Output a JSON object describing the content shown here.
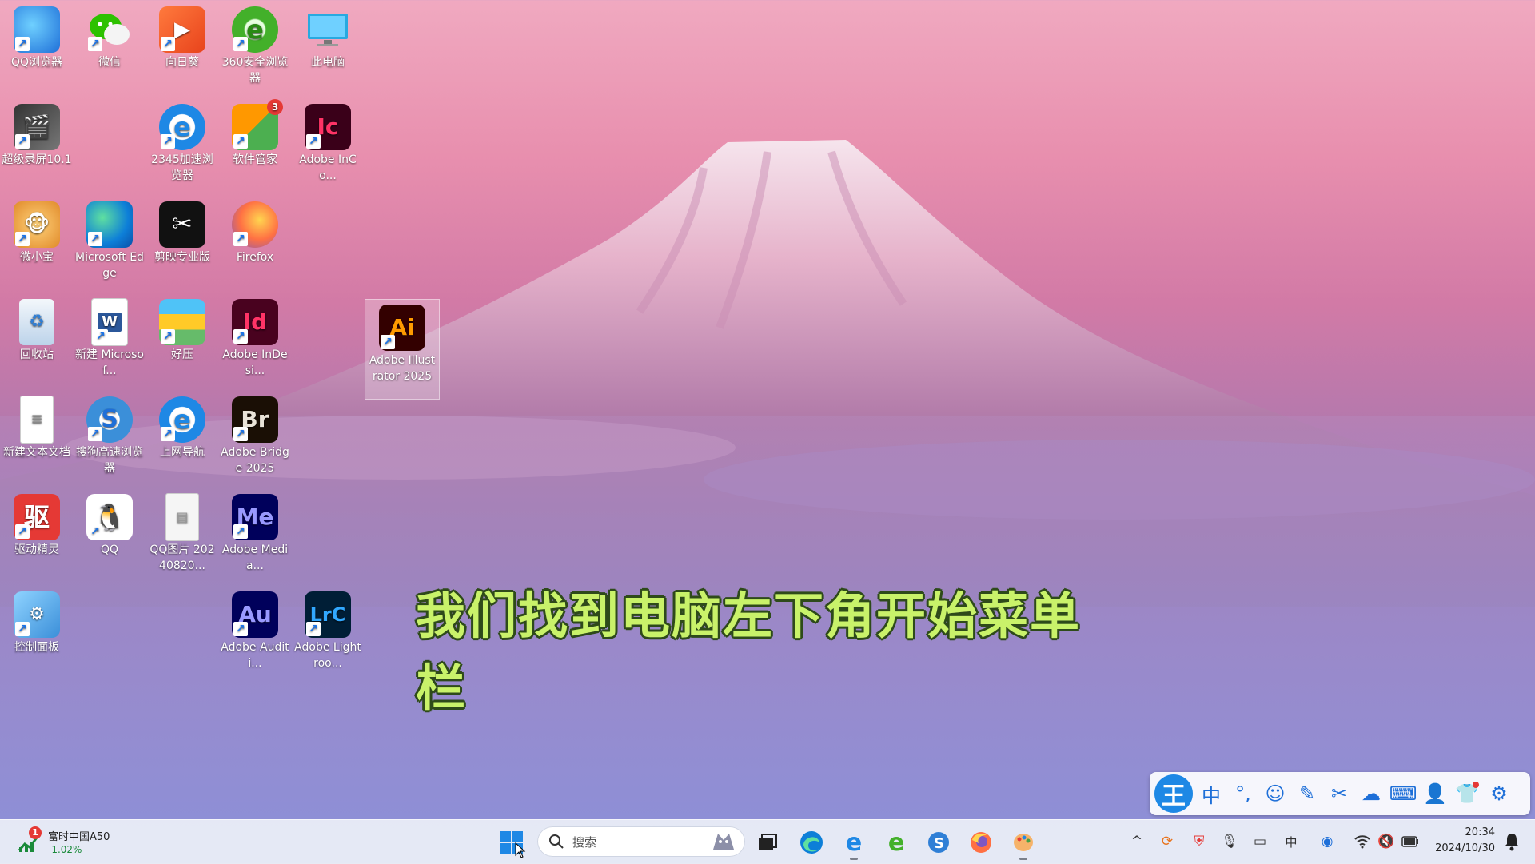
{
  "desktop": {
    "icons": [
      {
        "label": "QQ浏览器"
      },
      {
        "label": "微信"
      },
      {
        "label": "向日葵"
      },
      {
        "label": "360安全浏览器"
      },
      {
        "label": "此电脑"
      },
      {
        "label": "超级录屏10.1"
      },
      {
        "label": "2345加速浏览器"
      },
      {
        "label": "软件管家",
        "badge": "3"
      },
      {
        "label": "Adobe InCo...",
        "glyph": "Ic"
      },
      {
        "label": "微小宝"
      },
      {
        "label": "Microsoft Edge"
      },
      {
        "label": "剪映专业版"
      },
      {
        "label": "Firefox"
      },
      {
        "label": "回收站"
      },
      {
        "label": "新建 Microsof..."
      },
      {
        "label": "好压"
      },
      {
        "label": "Adobe InDesi...",
        "glyph": "Id"
      },
      {
        "label": "Adobe Illustrator 2025",
        "glyph": "Ai"
      },
      {
        "label": "新建文本文档"
      },
      {
        "label": "搜狗高速浏览器"
      },
      {
        "label": "上网导航"
      },
      {
        "label": "Adobe Bridge 2025",
        "glyph": "Br"
      },
      {
        "label": "驱动精灵"
      },
      {
        "label": "QQ"
      },
      {
        "label": "QQ图片 20240820..."
      },
      {
        "label": "Adobe Media...",
        "glyph": "Me"
      },
      {
        "label": "控制面板"
      },
      {
        "label": "Adobe Auditi...",
        "glyph": "Au"
      },
      {
        "label": "Adobe Lightroo...",
        "glyph": "LrC"
      }
    ],
    "subtitle": "我们找到电脑左下角开始菜单栏"
  },
  "ime_toolbar": {
    "logo": "王",
    "mode": "中",
    "punct": "°,"
  },
  "taskbar": {
    "stock": {
      "badge": "1",
      "name": "富时中国A50",
      "change": "-1.02%"
    },
    "search": {
      "placeholder": "搜索"
    },
    "tray": {
      "ime_indicator": "中"
    },
    "clock": {
      "time": "20:34",
      "date": "2024/10/30"
    }
  },
  "colors": {
    "subtitle": "#c9f26a",
    "subtitle_outline": "#2e4a1a",
    "accent": "#1e88e5"
  }
}
